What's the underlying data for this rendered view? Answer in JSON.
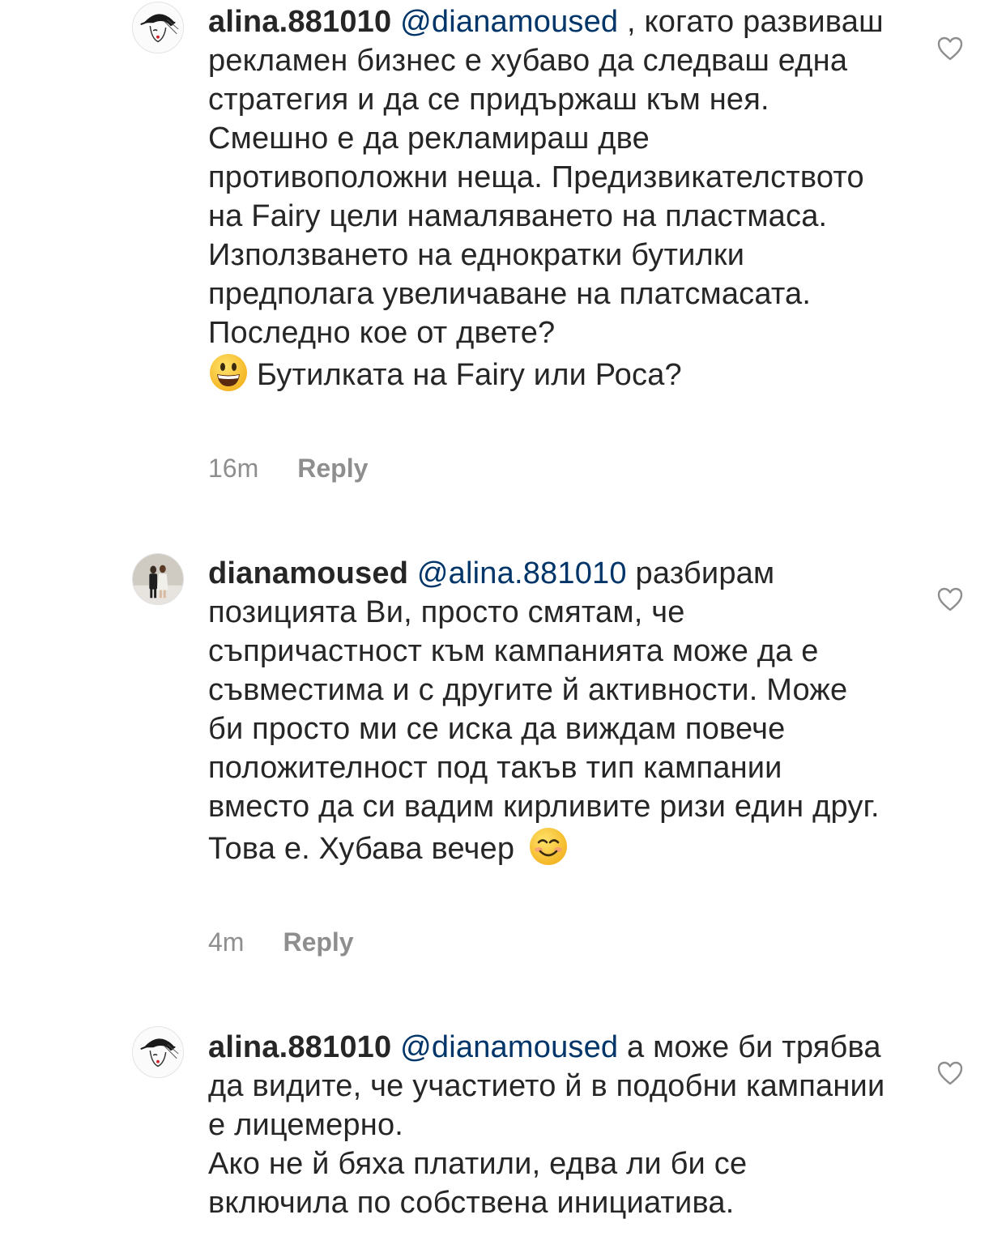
{
  "comments": [
    {
      "username": "alina.881010",
      "mention": "@dianamoused",
      "text": " , когато развиваш рекламен бизнес е хубаво да следваш една стратегия и да се придържаш към нея. Смешно е да рекламираш две противоположни неща. Предизвикателството на Fairy цели намаляването на пластмаса. Използването на еднократки бутилки предполага увеличаване на платсмасата. Последно кое от двете?",
      "emoji": "grinning-face",
      "text_after_emoji": "Бутилката на Fairy или Роса?",
      "time": "16m",
      "reply_label": "Reply",
      "avatar": "woman-in-hat-illustration",
      "like_icon": "heart-outline-icon"
    },
    {
      "username": "dianamoused",
      "mention": "@alina.881010",
      "text": " разбирам позицията Ви, просто смятам, че съпричастност към кампанията може да е съвместима и с другите й активности. Може би просто ми се иска да виждам повече положителност под такъв тип кампании вместо да си вадим кирливите ризи един друг. Това е. Хубава вечер",
      "emoji": "smiling-face",
      "time": "4m",
      "reply_label": "Reply",
      "avatar": "couple-photo",
      "like_icon": "heart-outline-icon"
    },
    {
      "username": "alina.881010",
      "mention": "@dianamoused",
      "text": " а може би трябва да видите, че участието й в подобни кампании е лицемерно.",
      "text_second_paragraph": "Ако не й бяха платили, едва ли би се включила по собствена инициатива.",
      "avatar": "woman-in-hat-illustration",
      "like_icon": "heart-outline-icon"
    }
  ],
  "colors": {
    "text": "#262626",
    "mention": "#003569",
    "muted": "#8e8e8e"
  }
}
